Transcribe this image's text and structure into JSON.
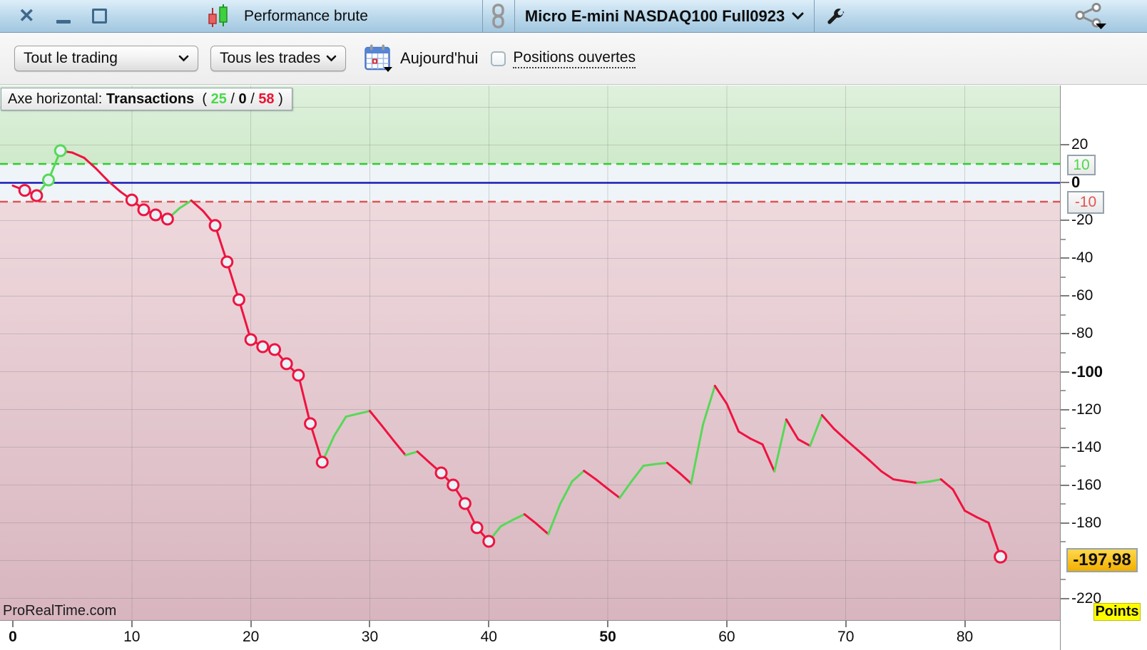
{
  "titlebar": {
    "performance_label": "Performance brute",
    "instrument": "Micro E-mini NASDAQ100 Full0923"
  },
  "icons": {
    "close": "✕"
  },
  "toolbar": {
    "scope_select": "Tout le trading",
    "trades_select": "Tous les trades",
    "date_label": "Aujourd'hui",
    "open_positions_label": "Positions ouvertes",
    "open_positions_checked": false
  },
  "badge": {
    "prefix": "Axe horizontal: ",
    "axis_name": "Transactions",
    "open": "  ( ",
    "wins": "25",
    "slash1": " / ",
    "neutral": "0",
    "slash2": " / ",
    "losses": "58",
    "close": " )"
  },
  "watermark": "ProRealTime.com",
  "boxes": {
    "upper": "10",
    "lower": "-10",
    "value": "-197,98",
    "unit": "Points"
  },
  "chart_data": {
    "type": "line",
    "x_axis_name": "Transactions",
    "y_unit": "Points",
    "trade_counts": {
      "wins": 25,
      "neutral": 0,
      "losses": 58
    },
    "final_value": -197.98,
    "x_max": 88,
    "y_range": [
      -231.5,
      51.5
    ],
    "zones": {
      "green_above": 10,
      "neutral_between": [
        -10,
        10
      ],
      "red_below": -10
    },
    "reference_lines": {
      "upper_dashed": 10,
      "zero": 0,
      "lower_dashed": -10
    },
    "x_ticks": [
      0,
      10,
      20,
      30,
      40,
      50,
      60,
      70,
      80
    ],
    "x_bold": [
      0,
      50
    ],
    "y_ticks": [
      {
        "v": 20,
        "label": "20",
        "bold": false
      },
      {
        "v": 0,
        "label": "0",
        "bold": true
      },
      {
        "v": -20,
        "label": "-20",
        "bold": false
      },
      {
        "v": -40,
        "label": "-40",
        "bold": false
      },
      {
        "v": -60,
        "label": "-60",
        "bold": false
      },
      {
        "v": -80,
        "label": "-80",
        "bold": false
      },
      {
        "v": -100,
        "label": "-100",
        "bold": true
      },
      {
        "v": -120,
        "label": "-120",
        "bold": false
      },
      {
        "v": -140,
        "label": "-140",
        "bold": false
      },
      {
        "v": -160,
        "label": "-160",
        "bold": false
      },
      {
        "v": -180,
        "label": "-180",
        "bold": false
      },
      {
        "v": -220,
        "label": "-220",
        "bold": false
      }
    ],
    "y_minor_ticks": [
      -30,
      -50,
      -70,
      -90,
      -110,
      -130,
      -150,
      -170,
      -190,
      -210
    ],
    "grid_y": [
      40,
      20,
      -20,
      -40,
      -60,
      -80,
      -100,
      -120,
      -140,
      -160,
      -180,
      -200,
      -220
    ],
    "values": [
      -1.5,
      -4,
      -6.8,
      1.5,
      17,
      16,
      13.2,
      7.5,
      1,
      -4.5,
      -9.1,
      -14.3,
      -17,
      -19.2,
      -13.5,
      -9.4,
      -15,
      -22.6,
      -41.9,
      -61.9,
      -83,
      -86.8,
      -88.3,
      -95.8,
      -101.9,
      -127.5,
      -147.9,
      -134,
      -123.8,
      -122.3,
      -120.8,
      -128.5,
      -136.5,
      -144.2,
      -142.3,
      -148,
      -153.6,
      -160,
      -169.8,
      -182.6,
      -189.8,
      -181.9,
      -178.5,
      -175.5,
      -180.5,
      -186,
      -170,
      -158.1,
      -152.5,
      -157,
      -162,
      -166.8,
      -158,
      -149.8,
      -148.9,
      -148.3,
      -153.5,
      -159.2,
      -128,
      -107.5,
      -117,
      -131.7,
      -135.5,
      -138.5,
      -152.8,
      -125.3,
      -135.8,
      -139.2,
      -123,
      -130.2,
      -136,
      -141.5,
      -147,
      -152.8,
      -157,
      -158,
      -158.9,
      -158.2,
      -157,
      -162.3,
      -173.6,
      -177,
      -180,
      -197.98
    ],
    "markers": [
      1,
      2,
      3,
      4,
      10,
      11,
      12,
      13,
      17,
      18,
      19,
      20,
      21,
      22,
      23,
      24,
      25,
      26,
      36,
      37,
      38,
      39,
      40,
      83
    ],
    "colors": {
      "win": "#56d957",
      "loss": "#ef1340",
      "zero_line": "#1a1ab8",
      "upper_dashed": "#2ecc2e",
      "lower_dashed": "#e05555",
      "marker_fill": "#e9f2f7",
      "green_zone_top": "#dff1dc",
      "green_zone_bottom": "#cfe9cb",
      "neutral_zone": "#eef4f7",
      "red_zone_top": "#eed9dd",
      "red_zone_bottom": "#d8b5bf",
      "value_box_bg": "#ffc926",
      "unit_box_bg": "#fdfd00"
    }
  }
}
